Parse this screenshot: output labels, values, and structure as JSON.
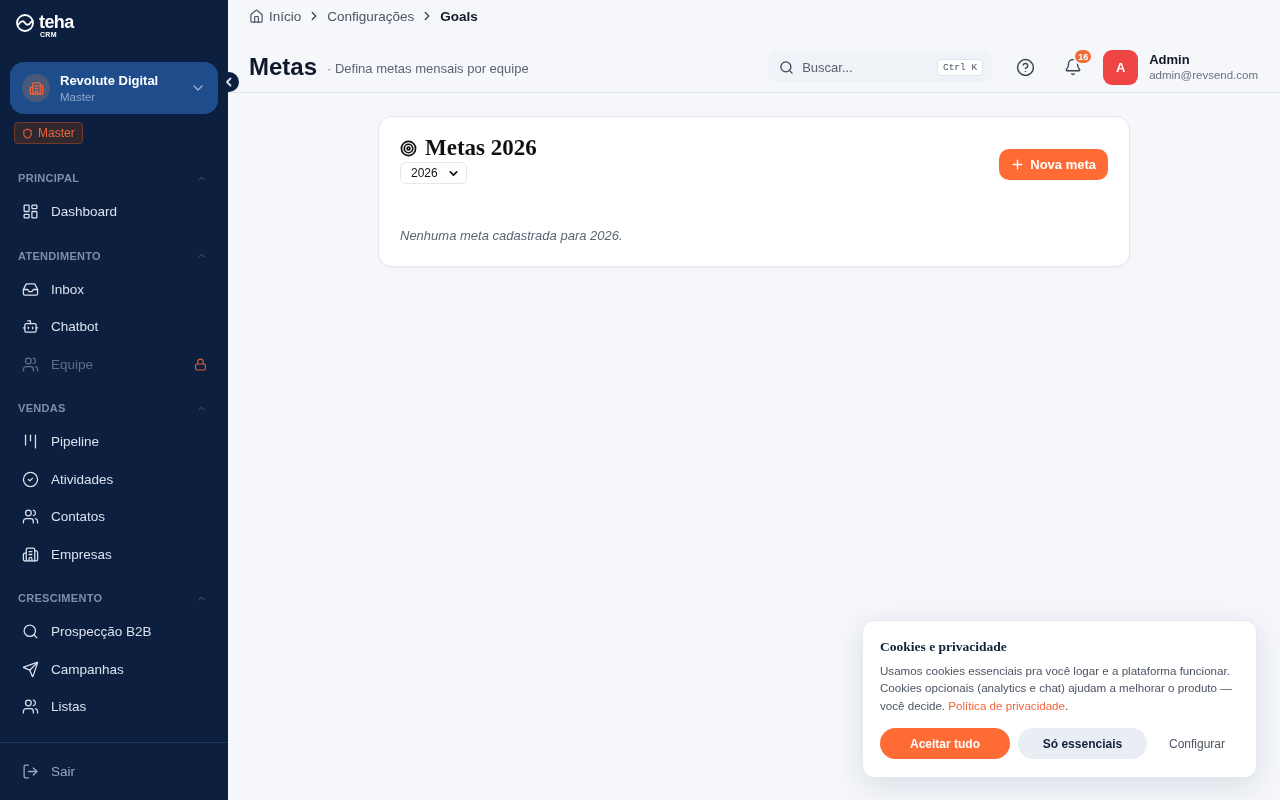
{
  "sidebar": {
    "brand": {
      "name": "teha",
      "tagline": "CRM"
    },
    "workspace": {
      "name": "Revolute Digital",
      "role": "Master"
    },
    "role_badge": "Master",
    "sections": [
      {
        "title": "PRINCIPAL",
        "expanded": true,
        "items": [
          {
            "label": "Dashboard",
            "selected": false,
            "disabled": false,
            "locked": false
          }
        ]
      },
      {
        "title": "ATENDIMENTO",
        "expanded": true,
        "items": [
          {
            "label": "Inbox",
            "selected": false,
            "disabled": false,
            "locked": false
          },
          {
            "label": "Chatbot",
            "selected": false,
            "disabled": false,
            "locked": false
          },
          {
            "label": "Equipe",
            "selected": false,
            "disabled": true,
            "locked": true
          }
        ]
      },
      {
        "title": "VENDAS",
        "expanded": true,
        "items": [
          {
            "label": "Pipeline",
            "selected": false,
            "disabled": false,
            "locked": false
          },
          {
            "label": "Atividades",
            "selected": false,
            "disabled": false,
            "locked": false
          },
          {
            "label": "Contatos",
            "selected": false,
            "disabled": false,
            "locked": false
          },
          {
            "label": "Empresas",
            "selected": false,
            "disabled": false,
            "locked": false
          }
        ]
      },
      {
        "title": "CRESCIMENTO",
        "expanded": true,
        "items": [
          {
            "label": "Prospecção B2B",
            "selected": false,
            "disabled": false,
            "locked": false
          },
          {
            "label": "Campanhas",
            "selected": false,
            "disabled": false,
            "locked": false
          },
          {
            "label": "Listas",
            "selected": false,
            "disabled": false,
            "locked": false
          }
        ]
      }
    ],
    "logout": "Sair"
  },
  "breadcrumb": [
    {
      "label": "Início",
      "current": false
    },
    {
      "label": "Configurações",
      "current": false
    },
    {
      "label": "Goals",
      "current": true
    }
  ],
  "header": {
    "title": "Metas",
    "subtitle": "· Defina metas mensais por equipe",
    "search": {
      "placeholder": "Buscar...",
      "shortcut": "Ctrl K"
    },
    "notifications": {
      "count": "16"
    },
    "user": {
      "initial": "A",
      "name": "Admin",
      "email": "admin@revsend.com"
    }
  },
  "goals_card": {
    "title": "Metas 2026",
    "year_select": {
      "value": "2026"
    },
    "new_button": "Nova meta",
    "empty_message": "Nenhuma meta cadastrada para 2026."
  },
  "cookie_banner": {
    "title": "Cookies e privacidade",
    "text": "Usamos cookies essenciais pra você logar e a plataforma funcionar. Cookies opcionais (analytics e chat) ajudam a melhorar o produto — você decide.",
    "link": "Política de privacidade",
    "text_end": ".",
    "buttons": [
      {
        "kind": "primary",
        "label": "Aceitar tudo"
      },
      {
        "kind": "secondary",
        "label": "Só essenciais"
      },
      {
        "kind": "text",
        "label": "Configurar"
      }
    ]
  }
}
